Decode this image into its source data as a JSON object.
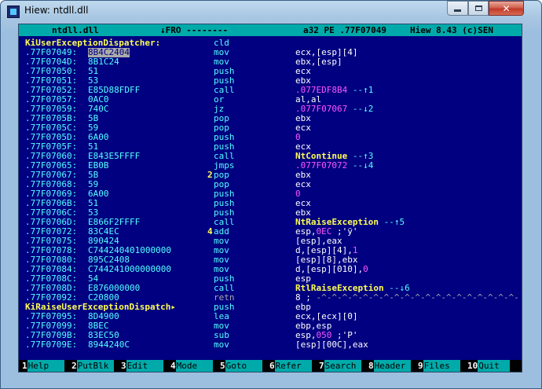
{
  "window": {
    "title": "Hiew: ntdll.dll"
  },
  "header": {
    "file": "ntdll.dll",
    "mode": "↓FRO --------",
    "info": "a32 PE .77F07049",
    "version": "Hiew 8.43 (c)SEN"
  },
  "code": {
    "label1": "KiUserExceptionDispatcher:",
    "label1_mn": "cld",
    "label2": "KiRaiseUserExceptionDispatch▸",
    "label2_mn": "push",
    "label2_op": "ebp",
    "lines": [
      {
        "addr": ".77F07049:",
        "hex": "8B4C2404",
        "mn": "mov",
        "op": "ecx,[esp][4]"
      },
      {
        "addr": ".77F0704D:",
        "hex": "8B1C24",
        "mn": "mov",
        "op": "ebx,[esp]"
      },
      {
        "addr": ".77F07050:",
        "hex": "51",
        "mn": "push",
        "op": "ecx"
      },
      {
        "addr": ".77F07051:",
        "hex": "53",
        "mn": "push",
        "op": "ebx"
      },
      {
        "addr": ".77F07052:",
        "hex": "E85D88FDFF",
        "mn": "call",
        "op": ".077EDF8B4",
        "arrow": "--↑1"
      },
      {
        "addr": ".77F07057:",
        "hex": "0AC0",
        "mn": "or",
        "op": "al,al"
      },
      {
        "addr": ".77F07059:",
        "hex": "740C",
        "mn": "jz",
        "op": ".077F07067",
        "arrow": "--↓2"
      },
      {
        "addr": ".77F0705B:",
        "hex": "5B",
        "mn": "pop",
        "op": "ebx"
      },
      {
        "addr": ".77F0705C:",
        "hex": "59",
        "mn": "pop",
        "op": "ecx"
      },
      {
        "addr": ".77F0705D:",
        "hex": "6A00",
        "mn": "push",
        "op": "0"
      },
      {
        "addr": ".77F0705F:",
        "hex": "51",
        "mn": "push",
        "op": "ecx"
      },
      {
        "addr": ".77F07060:",
        "hex": "E843E5FFFF",
        "mn": "call",
        "op": "NtContinue",
        "arrow": "--↑3"
      },
      {
        "addr": ".77F07065:",
        "hex": "EB0B",
        "mn": "jmps",
        "op": ".077F07072",
        "arrow": "--↓4"
      },
      {
        "addr": ".77F07067:",
        "hex": "5B",
        "mn": "pop",
        "op": "ebx",
        "mark": "2"
      },
      {
        "addr": ".77F07068:",
        "hex": "59",
        "mn": "pop",
        "op": "ecx"
      },
      {
        "addr": ".77F07069:",
        "hex": "6A00",
        "mn": "push",
        "op": "0"
      },
      {
        "addr": ".77F0706B:",
        "hex": "51",
        "mn": "push",
        "op": "ecx"
      },
      {
        "addr": ".77F0706C:",
        "hex": "53",
        "mn": "push",
        "op": "ebx"
      },
      {
        "addr": ".77F0706D:",
        "hex": "E866F2FFFF",
        "mn": "call",
        "op": "NtRaiseException",
        "arrow": "--↑5"
      },
      {
        "addr": ".77F07072:",
        "hex": "83C4EC",
        "mn": "add",
        "op": "esp,",
        "op2": "0EC",
        "op3": ";'ÿ'",
        "mark": "4"
      },
      {
        "addr": ".77F07075:",
        "hex": "890424",
        "mn": "mov",
        "op": "[esp],eax"
      },
      {
        "addr": ".77F07078:",
        "hex": "C744240401000000",
        "mn": "mov",
        "op": "d,[esp][4],",
        "op2": "1"
      },
      {
        "addr": ".77F07080:",
        "hex": "895C2408",
        "mn": "mov",
        "op": "[esp][8],ebx"
      },
      {
        "addr": ".77F07084:",
        "hex": "C744241000000000",
        "mn": "mov",
        "op": "d,[esp][010],",
        "op2": "0"
      },
      {
        "addr": ".77F0708C:",
        "hex": "54",
        "mn": "push",
        "op": "esp"
      },
      {
        "addr": ".77F0708D:",
        "hex": "E876000000",
        "mn": "call",
        "op": "RtlRaiseException",
        "arrow": "--↓6"
      },
      {
        "addr": ".77F07092:",
        "hex": "C20800",
        "mn": "retn",
        "op": "8 ;",
        "op2": " -^-^-^-^-^-^-^-^-^-^-^-^-^-^-^-^-^-^-^-"
      },
      {
        "addr": ".77F07095:",
        "hex": "8D4900",
        "mn": "lea",
        "op": "ecx,[ecx][0]"
      },
      {
        "addr": ".77F07099:",
        "hex": "8BEC",
        "mn": "mov",
        "op": "ebp,esp"
      },
      {
        "addr": ".77F0709B:",
        "hex": "83EC50",
        "mn": "sub",
        "op": "esp,",
        "op2": "050",
        "op3": ";'P'"
      },
      {
        "addr": ".77F0709E:",
        "hex": "8944240C",
        "mn": "mov",
        "op": "[esp][00C],eax"
      }
    ]
  },
  "fkeys": [
    {
      "n": "1",
      "label": "Help"
    },
    {
      "n": "2",
      "label": "PutBlk"
    },
    {
      "n": "3",
      "label": "Edit"
    },
    {
      "n": "4",
      "label": "Mode"
    },
    {
      "n": "5",
      "label": "Goto"
    },
    {
      "n": "6",
      "label": "Refer"
    },
    {
      "n": "7",
      "label": "Search"
    },
    {
      "n": "8",
      "label": "Header"
    },
    {
      "n": "9",
      "label": "Files"
    },
    {
      "n": "10",
      "label": "Quit"
    }
  ],
  "colors": {
    "background": "#000080",
    "address": "#55ffff",
    "label": "#ffff55",
    "symbol": "#ff55ff",
    "bar": "#00aaaa"
  },
  "icons": {
    "app": "hiew-app-icon",
    "minimize": "minimize-icon",
    "maximize": "maximize-icon",
    "close": "close-icon"
  }
}
